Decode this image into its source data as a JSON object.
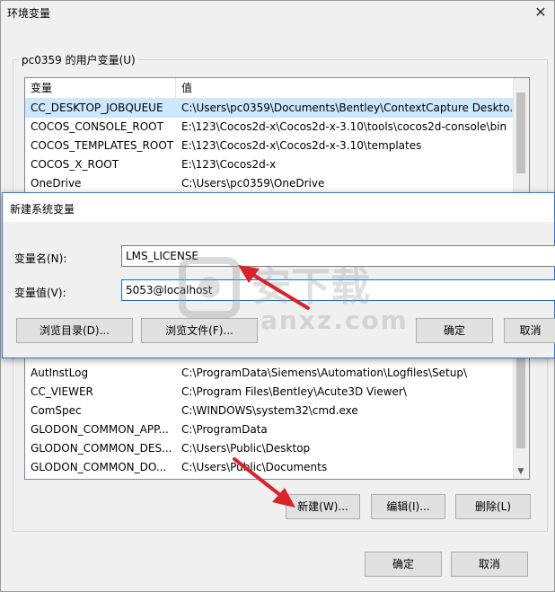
{
  "outer": {
    "title": "环境变量",
    "close_glyph": "✕",
    "user_group_label": "pc0359 的用户变量(U)",
    "columns": {
      "name": "变量",
      "value": "值"
    },
    "user_vars": [
      {
        "name": "CC_DESKTOP_JOBQUEUE",
        "value": "C:\\Users\\pc0359\\Documents\\Bentley\\ContextCapture Deskto..."
      },
      {
        "name": "COCOS_CONSOLE_ROOT",
        "value": "E:\\123\\Cocos2d-x\\Cocos2d-x-3.10\\tools\\cocos2d-console\\bin"
      },
      {
        "name": "COCOS_TEMPLATES_ROOT",
        "value": "E:\\123\\Cocos2d-x\\Cocos2d-x-3.10\\templates"
      },
      {
        "name": "COCOS_X_ROOT",
        "value": "E:\\123\\Cocos2d-x"
      },
      {
        "name": "OneDrive",
        "value": "C:\\Users\\pc0359\\OneDrive"
      }
    ],
    "system_vars": [
      {
        "name": "AutInstLog",
        "value": "C:\\ProgramData\\Siemens\\Automation\\Logfiles\\Setup\\"
      },
      {
        "name": "CC_VIEWER",
        "value": "C:\\Program Files\\Bentley\\Acute3D Viewer\\"
      },
      {
        "name": "ComSpec",
        "value": "C:\\WINDOWS\\system32\\cmd.exe"
      },
      {
        "name": "GLODON_COMMON_APP...",
        "value": "C:\\ProgramData"
      },
      {
        "name": "GLODON_COMMON_DES...",
        "value": "C:\\Users\\Public\\Desktop"
      },
      {
        "name": "GLODON_COMMON_DO...",
        "value": "C:\\Users\\Public\\Documents"
      }
    ],
    "buttons": {
      "new": "新建(W)...",
      "edit": "编辑(I)...",
      "delete": "删除(L)",
      "ok": "确定",
      "cancel": "取消"
    }
  },
  "dialog": {
    "title": "新建系统变量",
    "name_label": "变量名(N):",
    "value_label": "变量值(V):",
    "name_value": "LMS_LICENSE",
    "value_value": "5053@localhost",
    "buttons": {
      "browse_dir": "浏览目录(D)...",
      "browse_file": "浏览文件(F)...",
      "ok": "确定",
      "cancel": "取消"
    }
  },
  "watermark": {
    "text": "anxz.com"
  },
  "colors": {
    "selection": "#cce8ff",
    "accent": "#0078d7",
    "arrow": "#d8232a"
  }
}
